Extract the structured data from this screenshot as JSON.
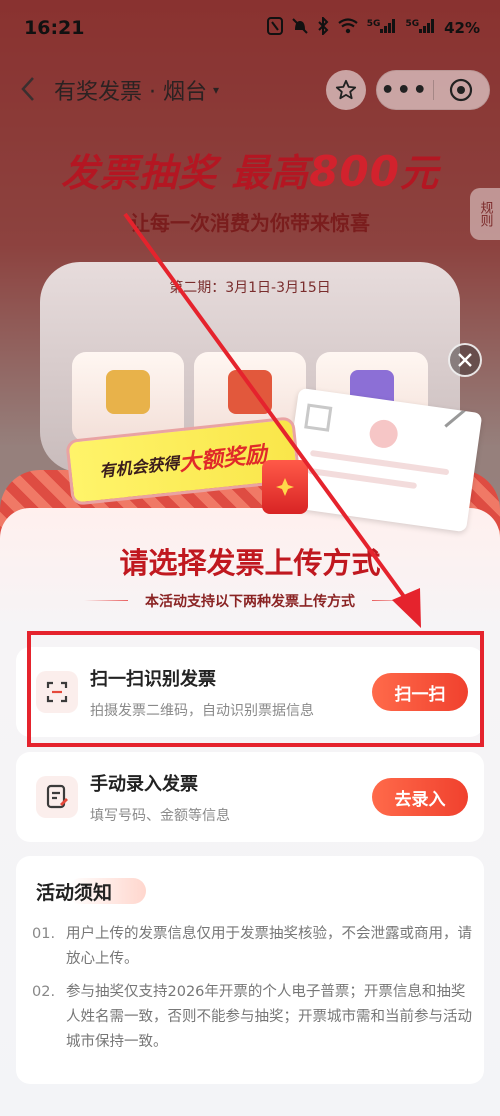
{
  "status_bar": {
    "time": "16:21",
    "signal1": "5G",
    "signal2": "5G",
    "battery": "42%"
  },
  "nav": {
    "title": "有奖发票 · 烟台",
    "caret": "▾"
  },
  "hero": {
    "title_main": "发票抽奖 最高",
    "title_amount": "800",
    "title_unit": "元",
    "subtitle": "让每一次消费为你带来惊喜",
    "rules_tab": "规则",
    "period": "第二期：3月1日-3月15日"
  },
  "promo": {
    "lead": "有机会获得",
    "strong": "大额奖励"
  },
  "sheet": {
    "title": "请选择发票上传方式",
    "subtitle": "本活动支持以下两种发票上传方式",
    "options": [
      {
        "title": "扫一扫识别发票",
        "desc": "拍摄发票二维码，自动识别票据信息",
        "button": "扫一扫",
        "icon": "scan-icon"
      },
      {
        "title": "手动录入发票",
        "desc": "填写号码、金额等信息",
        "button": "去录入",
        "icon": "edit-document-icon"
      }
    ]
  },
  "notice": {
    "title": "活动须知",
    "items": [
      {
        "num": "01.",
        "text": "用户上传的发票信息仅用于发票抽奖核验，不会泄露或商用，请放心上传。"
      },
      {
        "num": "02.",
        "text": "参与抽奖仅支持2026年开票的个人电子普票；开票信息和抽奖人姓名需一致，否则不能参与抽奖；开票城市需和当前参与活动城市保持一致。"
      }
    ]
  },
  "colors": {
    "accent": "#f0412e",
    "title_red": "#c0181f",
    "highlight": "#e5232d"
  }
}
